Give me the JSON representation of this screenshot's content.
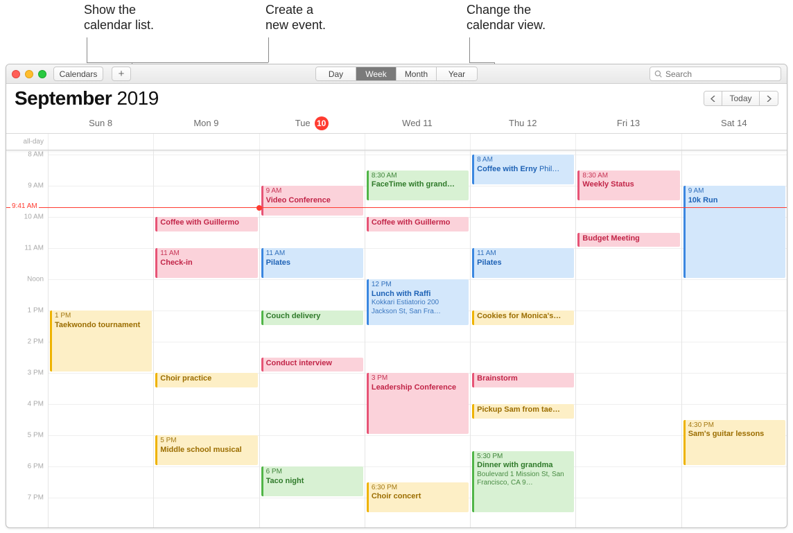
{
  "annotations": {
    "a1": "Show the\ncalendar list.",
    "a2": "Create a\nnew event.",
    "a3": "Change the\ncalendar view."
  },
  "toolbar": {
    "calendars_label": "Calendars",
    "plus_label": "+",
    "views": [
      "Day",
      "Week",
      "Month",
      "Year"
    ],
    "active_view_index": 1,
    "search_placeholder": "Search"
  },
  "header": {
    "month": "September",
    "year": "2019",
    "today_label": "Today"
  },
  "days": [
    {
      "label": "Sun",
      "num": "8"
    },
    {
      "label": "Mon",
      "num": "9"
    },
    {
      "label": "Tue",
      "num": "10",
      "today": true
    },
    {
      "label": "Wed",
      "num": "11"
    },
    {
      "label": "Thu",
      "num": "12"
    },
    {
      "label": "Fri",
      "num": "13"
    },
    {
      "label": "Sat",
      "num": "14"
    }
  ],
  "allday_label": "all-day",
  "hours": [
    "8 AM",
    "9 AM",
    "10 AM",
    "11 AM",
    "Noon",
    "1 PM",
    "2 PM",
    "3 PM",
    "4 PM",
    "5 PM",
    "6 PM",
    "7 PM"
  ],
  "hour_start": 8,
  "hour_height": 45,
  "now": {
    "label": "9:41 AM",
    "decimal_hour": 9.6833
  },
  "events": [
    {
      "day": 0,
      "start": 13.0,
      "end": 15.0,
      "time": "1 PM",
      "title": "Taekwondo tournament",
      "color": "yellow"
    },
    {
      "day": 1,
      "start": 10.0,
      "end": 10.5,
      "time": "",
      "title": "Coffee with Guillermo",
      "color": "pink"
    },
    {
      "day": 1,
      "start": 11.0,
      "end": 12.0,
      "time": "11 AM",
      "title": "Check-in",
      "color": "pink"
    },
    {
      "day": 1,
      "start": 15.0,
      "end": 15.5,
      "time": "",
      "title": "Choir practice",
      "color": "yellow"
    },
    {
      "day": 1,
      "start": 17.0,
      "end": 18.0,
      "time": "5 PM",
      "title": "Middle school musical",
      "color": "yellow"
    },
    {
      "day": 2,
      "start": 9.0,
      "end": 10.0,
      "time": "9 AM",
      "title": "Video Conference",
      "color": "pink"
    },
    {
      "day": 2,
      "start": 11.0,
      "end": 12.0,
      "time": "11 AM",
      "title": "Pilates",
      "color": "blue"
    },
    {
      "day": 2,
      "start": 13.0,
      "end": 13.5,
      "time": "",
      "title": "Couch delivery",
      "color": "green"
    },
    {
      "day": 2,
      "start": 14.5,
      "end": 15.0,
      "time": "",
      "title": "Conduct interview",
      "color": "pink"
    },
    {
      "day": 2,
      "start": 18.0,
      "end": 19.0,
      "time": "6 PM",
      "title": "Taco night",
      "color": "green"
    },
    {
      "day": 3,
      "start": 8.5,
      "end": 9.5,
      "time": "8:30 AM",
      "title": "FaceTime with grand…",
      "color": "green"
    },
    {
      "day": 3,
      "start": 10.0,
      "end": 10.5,
      "time": "",
      "title": "Coffee with Guillermo",
      "color": "pink"
    },
    {
      "day": 3,
      "start": 12.0,
      "end": 13.5,
      "time": "12 PM",
      "title": "Lunch with Raffi",
      "location": "Kokkari Estiatorio 200 Jackson St, San Fra…",
      "color": "blue"
    },
    {
      "day": 3,
      "start": 15.0,
      "end": 17.0,
      "time": "3 PM",
      "title": "Leadership Conference",
      "color": "pink"
    },
    {
      "day": 3,
      "start": 18.5,
      "end": 19.5,
      "time": "6:30 PM",
      "title": "Choir concert",
      "color": "yellow"
    },
    {
      "day": 4,
      "start": 8.0,
      "end": 9.0,
      "time": "8 AM",
      "title": "Coffee with Erny",
      "location": "Phil…",
      "color": "blue",
      "loc_inline": true
    },
    {
      "day": 4,
      "start": 11.0,
      "end": 12.0,
      "time": "11 AM",
      "title": "Pilates",
      "color": "blue"
    },
    {
      "day": 4,
      "start": 13.0,
      "end": 13.5,
      "time": "",
      "title": "Cookies for Monica's…",
      "color": "yellow"
    },
    {
      "day": 4,
      "start": 15.0,
      "end": 15.5,
      "time": "",
      "title": "Brainstorm",
      "color": "pink"
    },
    {
      "day": 4,
      "start": 16.0,
      "end": 16.5,
      "time": "",
      "title": "Pickup Sam from tae…",
      "color": "yellow"
    },
    {
      "day": 4,
      "start": 17.5,
      "end": 19.5,
      "time": "5:30 PM",
      "title": "Dinner with grandma",
      "location": "Boulevard 1 Mission St, San Francisco, CA 9…",
      "color": "green"
    },
    {
      "day": 5,
      "start": 8.5,
      "end": 9.5,
      "time": "8:30 AM",
      "title": "Weekly Status",
      "color": "pink"
    },
    {
      "day": 5,
      "start": 10.5,
      "end": 11.0,
      "time": "",
      "title": "Budget Meeting",
      "color": "pink"
    },
    {
      "day": 6,
      "start": 9.0,
      "end": 12.0,
      "time": "9 AM",
      "title": "10k Run",
      "color": "blue"
    },
    {
      "day": 6,
      "start": 16.5,
      "end": 18.0,
      "time": "4:30 PM",
      "title": "Sam's guitar lessons",
      "color": "yellow"
    }
  ]
}
